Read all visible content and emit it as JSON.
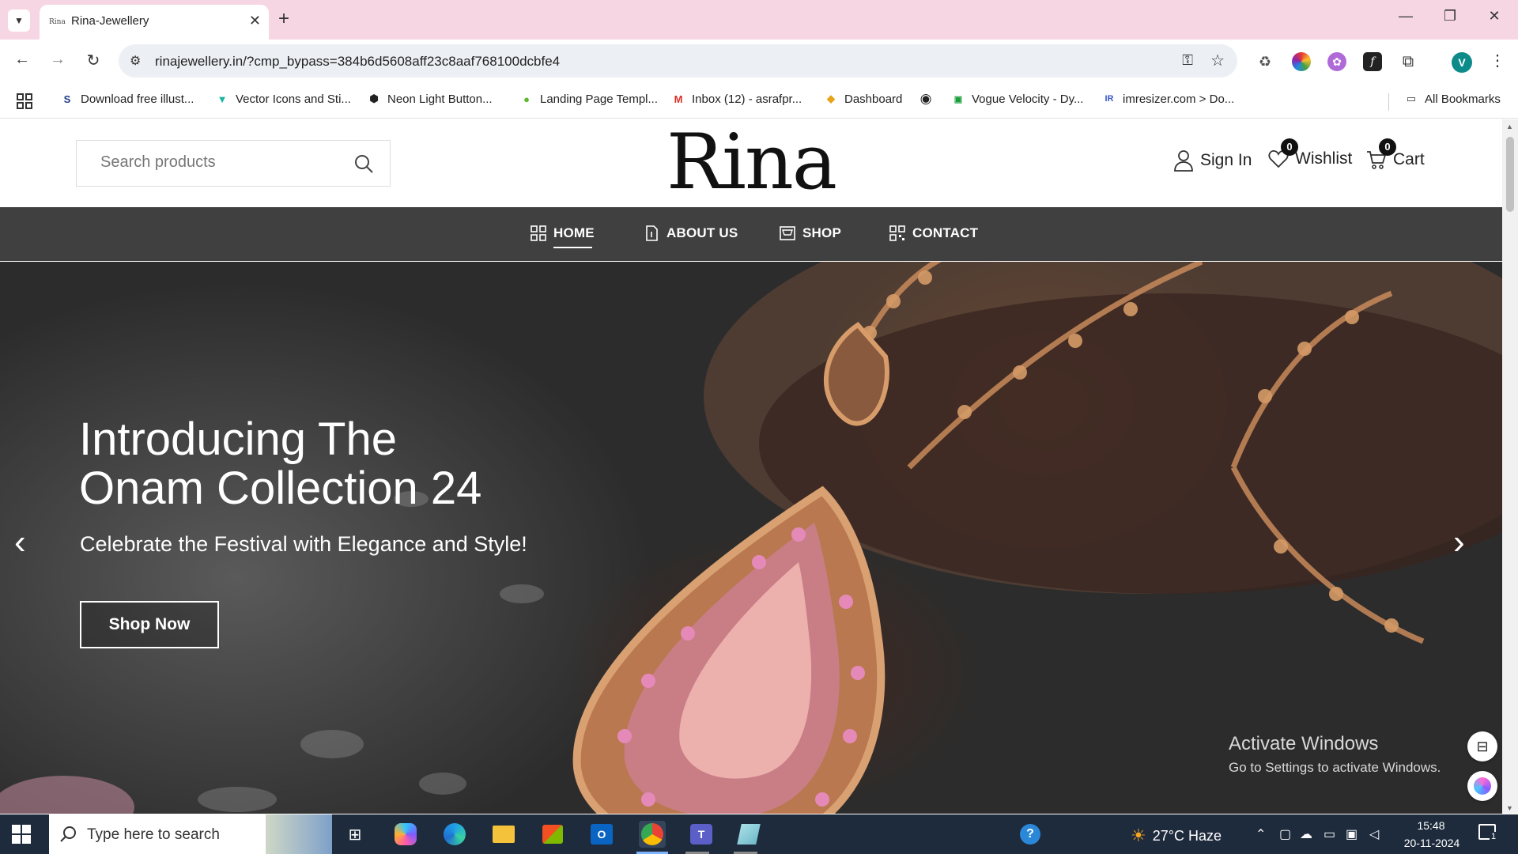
{
  "browser": {
    "tab_title": "Rina-Jewellery",
    "tab_favicon_text": "Rina",
    "url": "rinajewellery.in/?cmp_bypass=384b6d5608aff23c8aaf768100dcbfe4",
    "profile_initial": "V",
    "bookmarks": [
      {
        "label": "Download free illust...",
        "icon": "S",
        "color": "#1f3c88"
      },
      {
        "label": "Vector Icons and Sti...",
        "icon": "▼",
        "color": "#16b6a0"
      },
      {
        "label": "Neon Light Button...",
        "icon": "⬢",
        "color": "#222222"
      },
      {
        "label": "Landing Page Templ...",
        "icon": "●",
        "color": "#5cb82c"
      },
      {
        "label": "Inbox (12) - asrafpr...",
        "icon": "M",
        "color": "#d93025"
      },
      {
        "label": "Dashboard",
        "icon": "◆",
        "color": "#e8a317"
      }
    ],
    "bookmarks_more": [
      {
        "label": "Vogue Velocity - Dy...",
        "icon": "▣",
        "color": "#1a9e3a"
      },
      {
        "label": "imresizer.com > Do...",
        "icon": "IR",
        "color": "#3a57c7"
      }
    ],
    "all_bookmarks": "All Bookmarks"
  },
  "header": {
    "search_placeholder": "Search products",
    "logo": "Rina",
    "sign_in": "Sign In",
    "wishlist": "Wishlist",
    "wishlist_count": "0",
    "cart": "Cart",
    "cart_count": "0"
  },
  "nav": {
    "home": "HOME",
    "about": "ABOUT US",
    "shop": "SHOP",
    "contact": "CONTACT"
  },
  "hero": {
    "title": "Introducing The\nOnam Collection 24",
    "subtitle": "Celebrate the Festival with Elegance and Style!",
    "cta": "Shop Now",
    "prev": "‹",
    "next": "›"
  },
  "watermark": {
    "title": "Activate Windows",
    "subtitle": "Go to Settings to activate Windows."
  },
  "taskbar": {
    "search_placeholder": "Type here to search",
    "weather": "27°C  Haze",
    "time": "15:48",
    "date": "20-11-2024",
    "notif_count": "1"
  }
}
